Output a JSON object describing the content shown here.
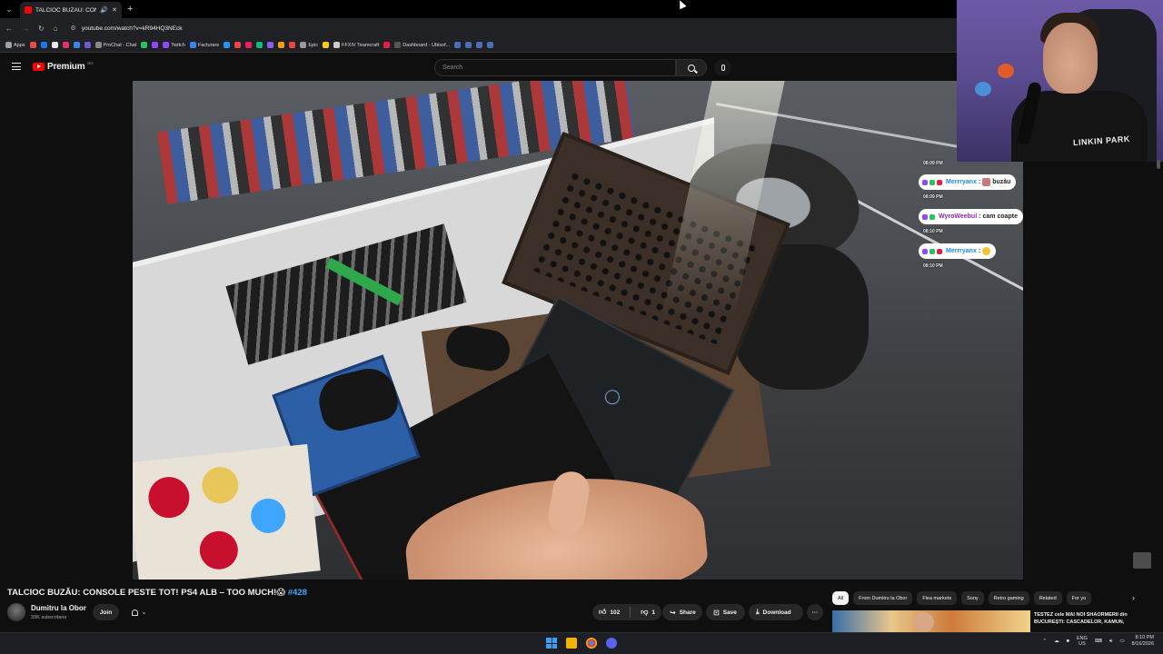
{
  "browser": {
    "tab_title": "TALCIOC BUZĂU: CONSOLE",
    "new_tab": "+",
    "url": "youtube.com/watch?v=kR94HQ3NEck",
    "bookmarks": [
      {
        "label": "Apps",
        "color": "#9aa0a6"
      },
      {
        "label": "",
        "color": "#e84a4a"
      },
      {
        "label": "",
        "color": "#1877f2"
      },
      {
        "label": "",
        "color": "#e8e8e8"
      },
      {
        "label": "",
        "color": "#e1306c"
      },
      {
        "label": "",
        "color": "#3b82f6"
      },
      {
        "label": "",
        "color": "#6d5acd"
      },
      {
        "label": "ProChat - Chat",
        "color": "#888888"
      },
      {
        "label": "",
        "color": "#22c55e"
      },
      {
        "label": "",
        "color": "#9146ff"
      },
      {
        "label": "Twitch",
        "color": "#9146ff"
      },
      {
        "label": "Facturare",
        "color": "#3b82f6"
      },
      {
        "label": "",
        "color": "#2196f3"
      },
      {
        "label": "",
        "color": "#ef4444"
      },
      {
        "label": "",
        "color": "#e91e63"
      },
      {
        "label": "",
        "color": "#10b981"
      },
      {
        "label": "",
        "color": "#8b5cf6"
      },
      {
        "label": "",
        "color": "#f59e0b"
      },
      {
        "label": "",
        "color": "#ef4444"
      },
      {
        "label": "Epic",
        "color": "#999999"
      },
      {
        "label": "",
        "color": "#facc15"
      },
      {
        "label": "FFXIV Teamcraft",
        "color": "#cccccc"
      },
      {
        "label": "",
        "color": "#e11d48"
      },
      {
        "label": "Dashboard - Ubisof...",
        "color": "#555555"
      },
      {
        "label": "",
        "color": "#4b6cb7"
      },
      {
        "label": "",
        "color": "#4b6cb7"
      },
      {
        "label": "",
        "color": "#4b6cb7"
      },
      {
        "label": "",
        "color": "#4b6cb7"
      }
    ]
  },
  "youtube": {
    "logo": "Premium",
    "logo_sup": "RO",
    "search_placeholder": "Search"
  },
  "webcam": {
    "shirt_text": "LINKIN PARK"
  },
  "chat": [
    {
      "time": "08:09 PM",
      "user": "Merrryanx",
      "text": "buzău",
      "user_color": "#1e88e5"
    },
    {
      "time": "08:09 PM",
      "user": "WyroWeebul",
      "text": "cam coapte",
      "user_color": "#8e24aa"
    },
    {
      "time": "08:10 PM",
      "user": "Merrryanx",
      "text": "",
      "user_color": "#1e88e5"
    },
    {
      "time": "08:10 PM"
    }
  ],
  "video": {
    "title": "TALCIOC BUZĂU: CONSOLE PESTE TOT! PS4 ALB – TOO MUCH!😱",
    "tag": "#428",
    "channel": "Dumitru la Obor",
    "subscribers": "33K subscribers",
    "join_label": "Join",
    "likes": "102",
    "dislikes": "1",
    "share_label": "Share",
    "save_label": "Save",
    "download_label": "Download",
    "more_label": "···"
  },
  "chips": [
    "All",
    "From Dumitru la Obor",
    "Flea markets",
    "Sony",
    "Retro gaming",
    "Related",
    "For yo"
  ],
  "recommendation": {
    "title": "TESTEZ cele MAI NOI SHAORMERII din BUCUREȘTI: CASCADELOR, KAMUN,"
  },
  "taskbar": {
    "lang_top": "ENG",
    "lang_bottom": "US",
    "time": "8:10 PM",
    "date": "8/16/2026"
  },
  "colors": {
    "yt_red": "#ff0000",
    "link_blue": "#3ea6ff",
    "background": "#0f0f0f"
  }
}
